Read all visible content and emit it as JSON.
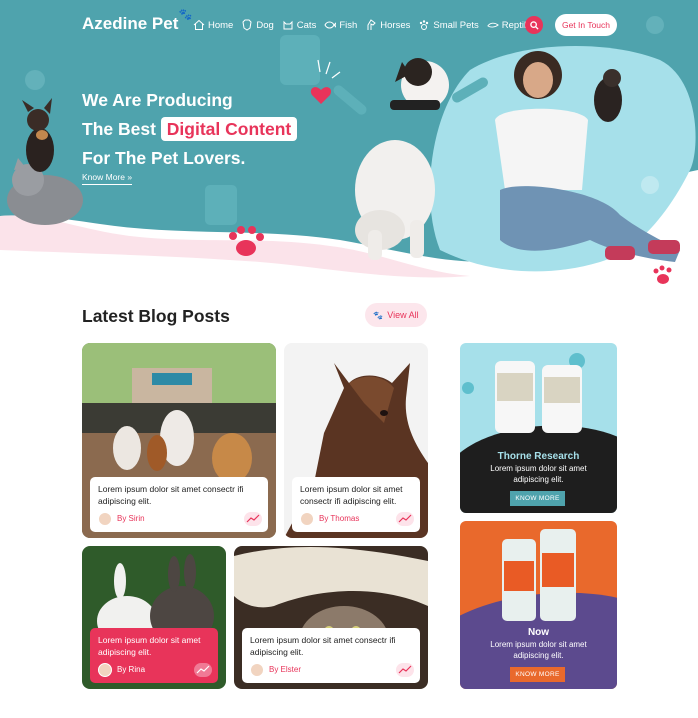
{
  "brand": {
    "name": "Azedine Pet"
  },
  "nav": {
    "items": [
      {
        "label": "Home",
        "icon": "home-icon"
      },
      {
        "label": "Dog",
        "icon": "dog-icon"
      },
      {
        "label": "Cats",
        "icon": "cat-icon"
      },
      {
        "label": "Fish",
        "icon": "fish-icon"
      },
      {
        "label": "Horses",
        "icon": "horse-icon"
      },
      {
        "label": "Small Pets",
        "icon": "paw-icon"
      },
      {
        "label": "Reptiles",
        "icon": "reptile-icon"
      }
    ],
    "cta_label": "Get In Touch"
  },
  "hero": {
    "line1": "We Are Producing",
    "line2_prefix": "The Best",
    "line2_highlight": "Digital Content",
    "line3": "For The Pet Lovers.",
    "know_more": "Know More »"
  },
  "blog": {
    "title": "Latest Blog Posts",
    "view_all": "View All",
    "posts": [
      {
        "text": "Lorem ipsum dolor sit amet consectr ifi adipiscing elit.",
        "author": "By Sirin"
      },
      {
        "text": "Lorem ipsum dolor sit amet consectr ifi adipiscing elit.",
        "author": "By Thomas"
      },
      {
        "text": "Lorem ipsum dolor sit amet adipiscing elit.",
        "author": "By Rina"
      },
      {
        "text": "Lorem ipsum dolor sit amet consectr ifi adipiscing elit.",
        "author": "By Elster"
      }
    ]
  },
  "ads": [
    {
      "title": "Thorne Research",
      "text_line1": "Lorem ipsum dolor sit amet",
      "text_line2": "adipiscing elit.",
      "button": "KNOW MORE"
    },
    {
      "title": "Now",
      "text_line1": "Lorem ipsum dolor sit amet",
      "text_line2": "adipiscing elit.",
      "button": "KNOW MORE"
    }
  ],
  "colors": {
    "teal": "#4fa3ad",
    "pink": "#e8345a",
    "light_blue": "#a6e0ea",
    "orange": "#e9692c"
  }
}
